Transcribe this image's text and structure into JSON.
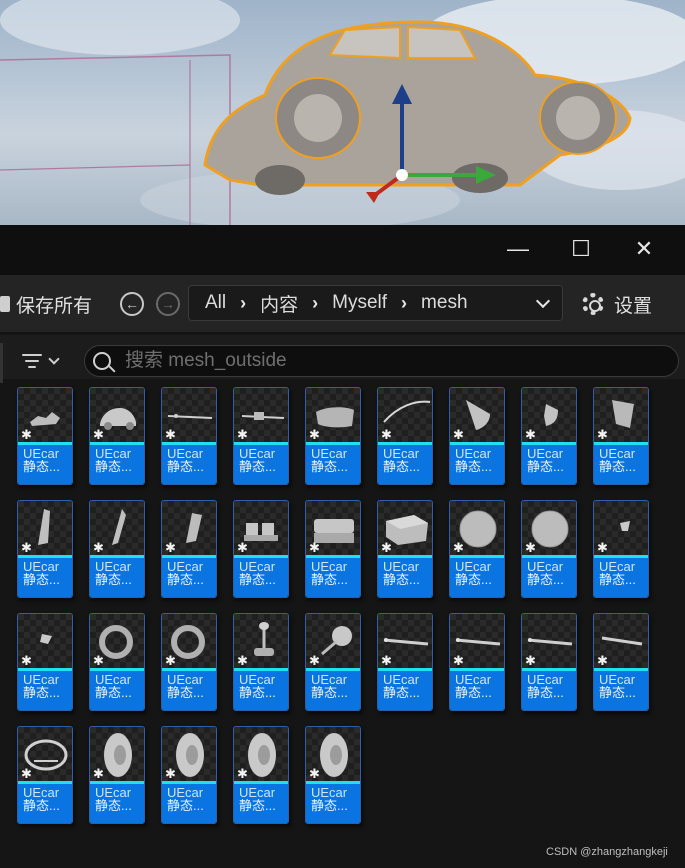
{
  "viewport": {
    "description_icon": "car-mesh"
  },
  "window": {
    "controls": {
      "minimize": "—",
      "maximize": "☐",
      "close": "✕"
    }
  },
  "toolbar": {
    "save_all_label": "保存所有",
    "back_icon": "←",
    "forward_icon": "→",
    "breadcrumb": [
      "All",
      "内容",
      "Myself",
      "mesh"
    ],
    "breadcrumb_dropdown_icon": "⌄",
    "settings_label": "设置"
  },
  "filter": {
    "search_placeholder": "搜索 mesh_outside"
  },
  "assets": [
    {
      "name": "UEcar",
      "type": "静态...",
      "shape": "part-small"
    },
    {
      "name": "UEcar",
      "type": "静态...",
      "shape": "car"
    },
    {
      "name": "UEcar",
      "type": "静态...",
      "shape": "rod-long"
    },
    {
      "name": "UEcar",
      "type": "静态...",
      "shape": "rod-knob"
    },
    {
      "name": "UEcar",
      "type": "静态...",
      "shape": "panel-curved"
    },
    {
      "name": "UEcar",
      "type": "静态...",
      "shape": "arc"
    },
    {
      "name": "UEcar",
      "type": "静态...",
      "shape": "quarter"
    },
    {
      "name": "UEcar",
      "type": "静态...",
      "shape": "quarter-small"
    },
    {
      "name": "UEcar",
      "type": "静态...",
      "shape": "plate"
    },
    {
      "name": "UEcar",
      "type": "静态...",
      "shape": "window-tall"
    },
    {
      "name": "UEcar",
      "type": "静态...",
      "shape": "window-slim"
    },
    {
      "name": "UEcar",
      "type": "静态...",
      "shape": "window-flat"
    },
    {
      "name": "UEcar",
      "type": "静态...",
      "shape": "seats-small"
    },
    {
      "name": "UEcar",
      "type": "静态...",
      "shape": "seat-bench"
    },
    {
      "name": "UEcar",
      "type": "静态...",
      "shape": "box"
    },
    {
      "name": "UEcar",
      "type": "静态...",
      "shape": "disc"
    },
    {
      "name": "UEcar",
      "type": "静态...",
      "shape": "disc"
    },
    {
      "name": "UEcar",
      "type": "静态...",
      "shape": "shard"
    },
    {
      "name": "UEcar",
      "type": "静态...",
      "shape": "shard-small"
    },
    {
      "name": "UEcar",
      "type": "静态...",
      "shape": "ring"
    },
    {
      "name": "UEcar",
      "type": "静态...",
      "shape": "ring"
    },
    {
      "name": "UEcar",
      "type": "静态...",
      "shape": "lever"
    },
    {
      "name": "UEcar",
      "type": "静态...",
      "shape": "mirror"
    },
    {
      "name": "UEcar",
      "type": "静态...",
      "shape": "axle"
    },
    {
      "name": "UEcar",
      "type": "静态...",
      "shape": "axle"
    },
    {
      "name": "UEcar",
      "type": "静态...",
      "shape": "axle"
    },
    {
      "name": "UEcar",
      "type": "静态...",
      "shape": "axle-short"
    },
    {
      "name": "UEcar",
      "type": "静态...",
      "shape": "steering-wheel"
    },
    {
      "name": "UEcar",
      "type": "静态...",
      "shape": "wheel"
    },
    {
      "name": "UEcar",
      "type": "静态...",
      "shape": "wheel"
    },
    {
      "name": "UEcar",
      "type": "静态...",
      "shape": "wheel"
    },
    {
      "name": "UEcar",
      "type": "静态...",
      "shape": "wheel"
    }
  ],
  "watermark": "CSDN @zhangzhangkeji"
}
